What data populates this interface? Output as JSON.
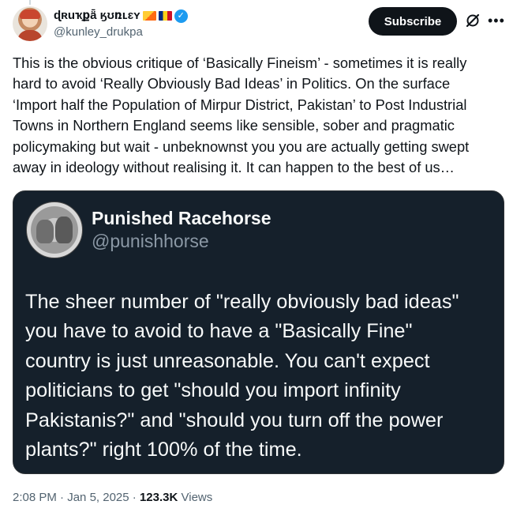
{
  "author": {
    "display_name": "ɖʀuҡքǟ ӄʊռʟɛʏ",
    "handle": "@kunley_drukpa",
    "flags": [
      "bhutan-flag-icon",
      "romania-flag-icon"
    ],
    "verified_icon": "verified-badge-icon"
  },
  "actions": {
    "subscribe_label": "Subscribe",
    "grok_icon": "grok-icon",
    "more_icon": "more-options-icon",
    "more_glyph": "•••"
  },
  "tweet": {
    "text": "This is the obvious critique of ‘Basically Fineism’ - sometimes it is really\nhard to avoid ‘Really Obviously Bad Ideas’ in Politics. On the surface\n‘Import half the Population of Mirpur District, Pakistan’ to Post Industrial\nTowns in Northern England seems like sensible, sober and pragmatic\npolicymaking but wait - unbeknownst you you are actually getting swept\naway in ideology without realising it. It can happen to the best of us…"
  },
  "media": {
    "name": "Punished Racehorse",
    "handle": "@punishhorse",
    "text": "The sheer number of \"really obviously bad ideas\"\nyou have to avoid to have a \"Basically Fine\"\ncountry is just unreasonable. You can't expect\npoliticians to get \"should you import infinity\nPakistanis?\" and \"should you turn off the power\nplants?\" right 100% of the time."
  },
  "meta": {
    "time": "2:08 PM",
    "separator": "·",
    "date": "Jan 5, 2025",
    "views_count": "123.3K",
    "views_label": "Views"
  },
  "colors": {
    "accent": "#1d9bf0",
    "text_primary": "#0f1419",
    "text_secondary": "#536471",
    "media_background": "#15202b"
  }
}
